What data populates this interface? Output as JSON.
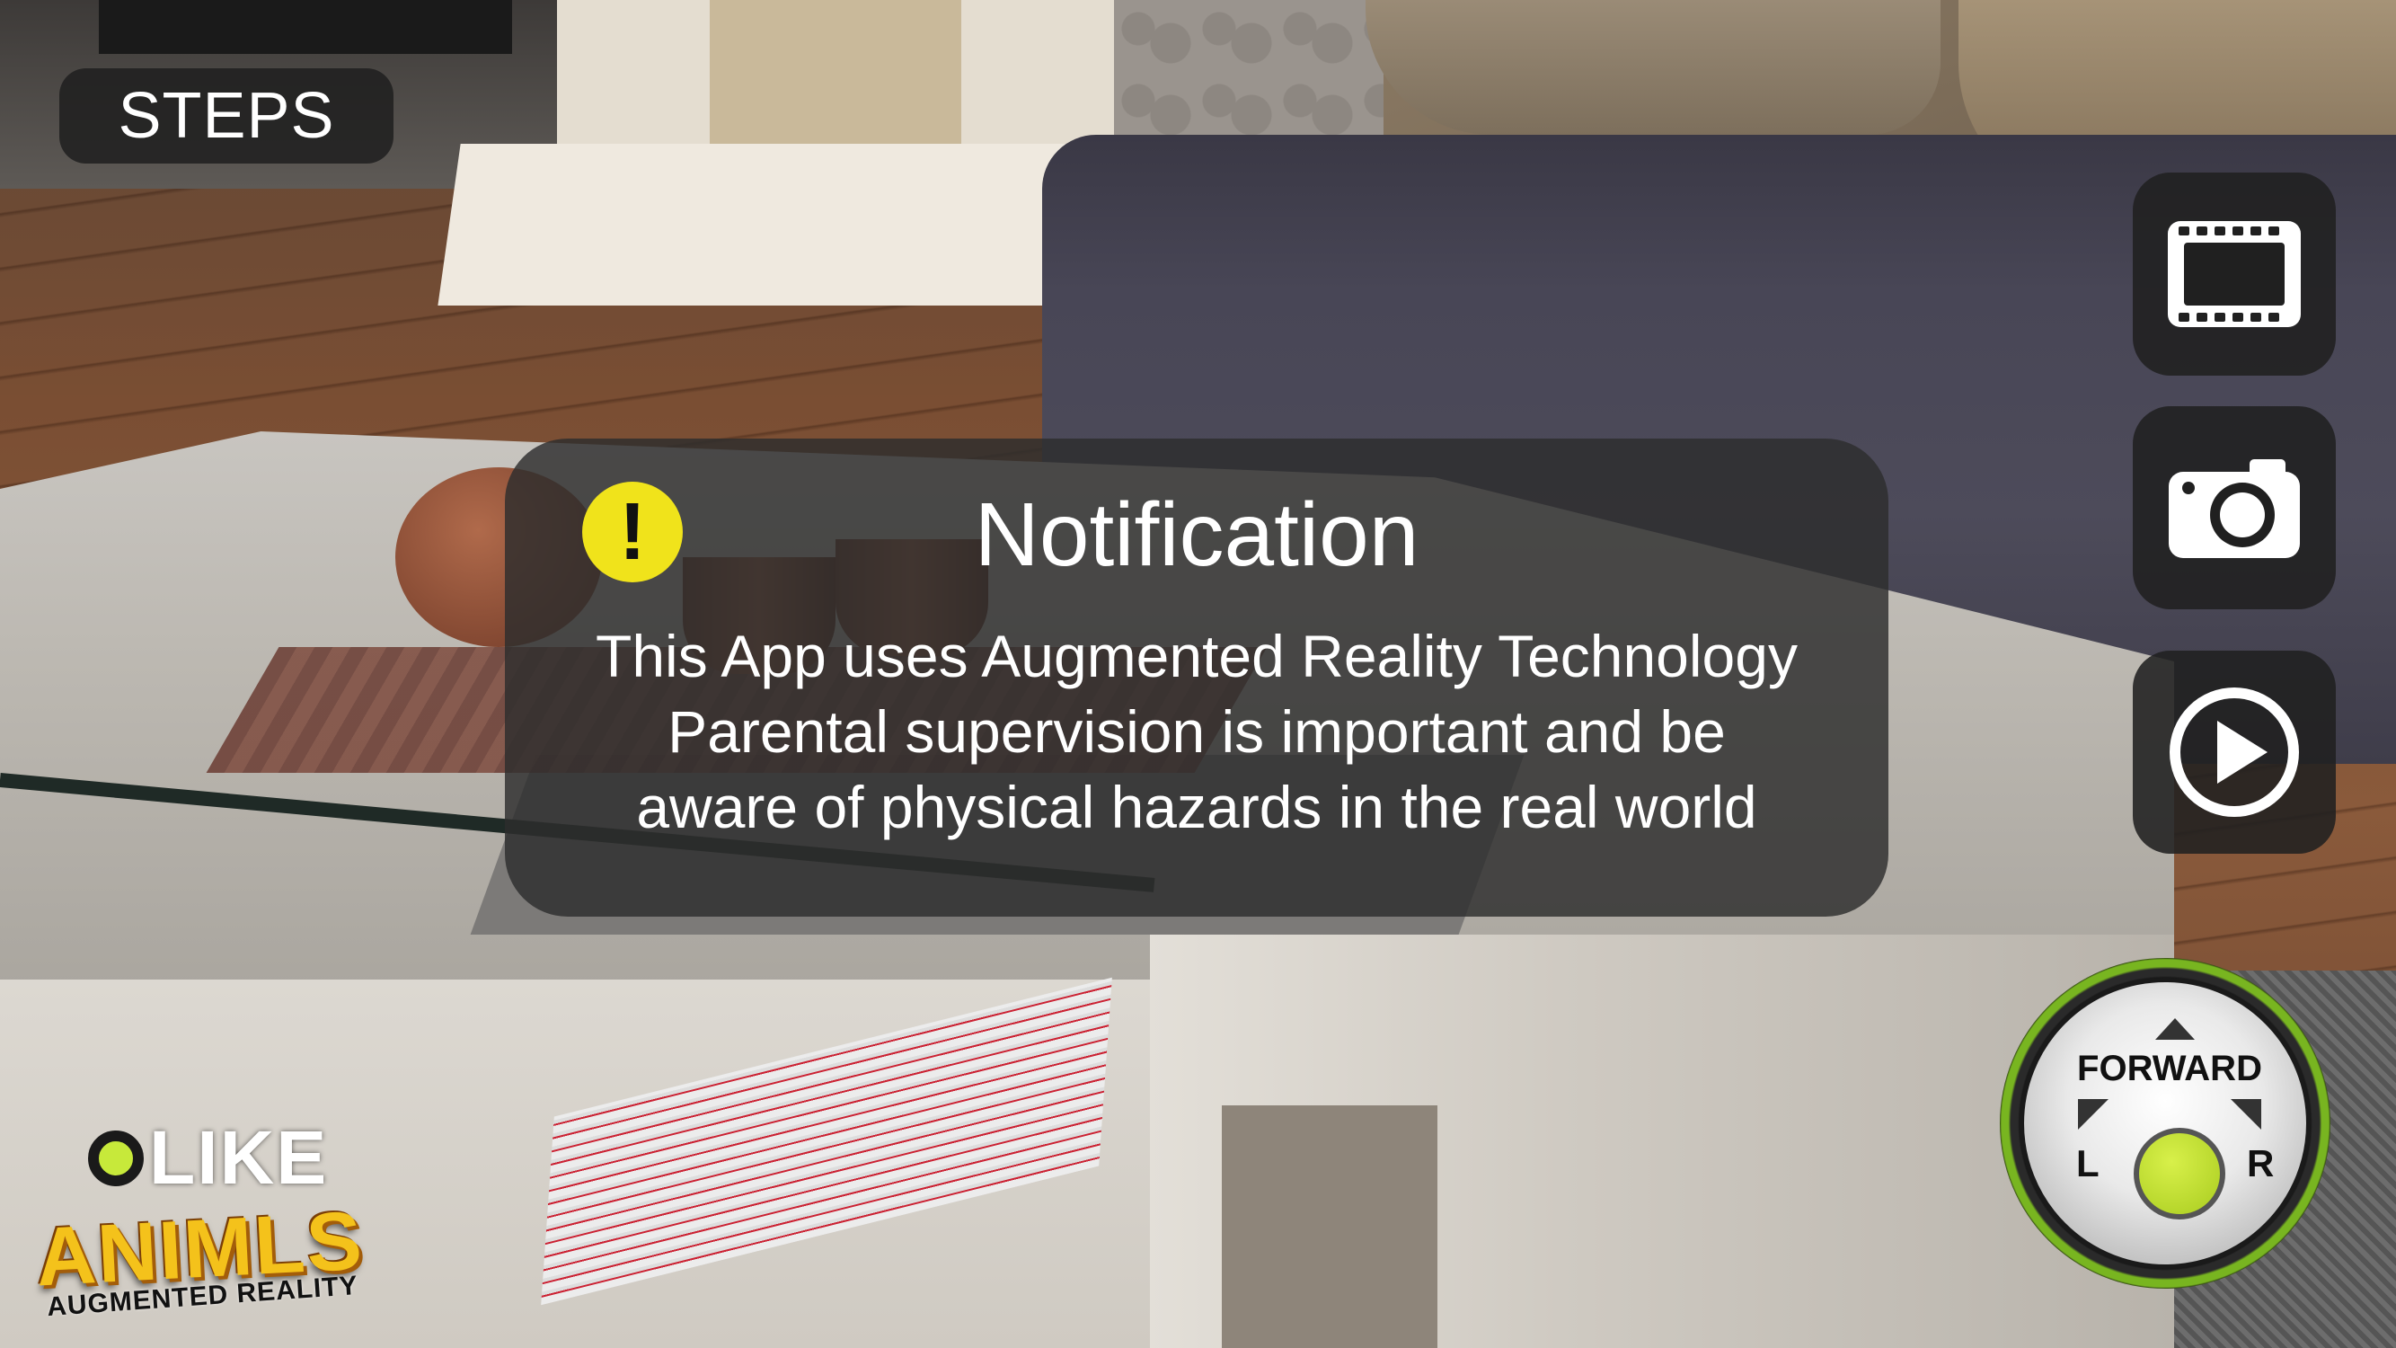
{
  "steps_button": {
    "label": "STEPS"
  },
  "side_buttons": [
    {
      "icon": "film-icon"
    },
    {
      "icon": "camera-icon"
    },
    {
      "icon": "play-icon"
    }
  ],
  "notification": {
    "icon": "warning-icon",
    "icon_glyph": "!",
    "title": "Notification",
    "lines": [
      "This App uses Augmented Reality Technology",
      "Parental supervision is important and be",
      "aware of physical hazards in the real world"
    ]
  },
  "joystick": {
    "forward_label": "FORWARD",
    "left_label": "L",
    "right_label": "R"
  },
  "logo": {
    "brand": "LIKE",
    "name": "ANIMLS",
    "tagline": "AUGMENTED REALITY"
  },
  "colors": {
    "panel_bg": "#2d2d2d",
    "warning_yellow": "#f0e31b",
    "joystick_knob": "#b9d82a",
    "logo_gold": "#f4c21b"
  }
}
